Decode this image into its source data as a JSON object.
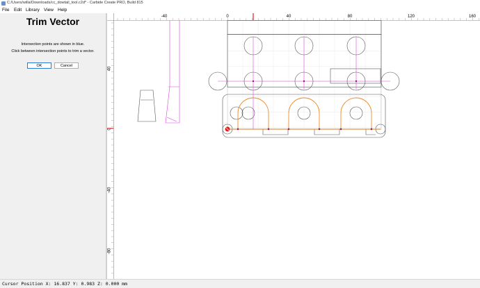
{
  "window": {
    "title": "C:/Users/willa/Downloads/cc_dowtail_tool.c2d* - Carbide Create PRO, Build 815"
  },
  "menu": {
    "file": "File",
    "edit": "Edit",
    "library": "Library",
    "view": "View",
    "help": "Help"
  },
  "panel": {
    "title": "Trim Vector",
    "line1": "Intersection points are shown in blue.",
    "line2": "Click between intersection points to trim a vector.",
    "ok": "OK",
    "cancel": "Cancel"
  },
  "ruler": {
    "top": [
      "-40",
      "0",
      "40",
      "80",
      "120",
      "160"
    ],
    "left": [
      "40",
      "0",
      "-40",
      "-80"
    ]
  },
  "status": {
    "cursor": "Cursor Position X: 16.837 Y: 0.983 Z: 0.000 mm"
  },
  "colors": {
    "magenta": "#e040e0",
    "orange": "#f08a2a",
    "red": "#e02020",
    "grid": "#d6d6d6",
    "shape": "#555555"
  }
}
